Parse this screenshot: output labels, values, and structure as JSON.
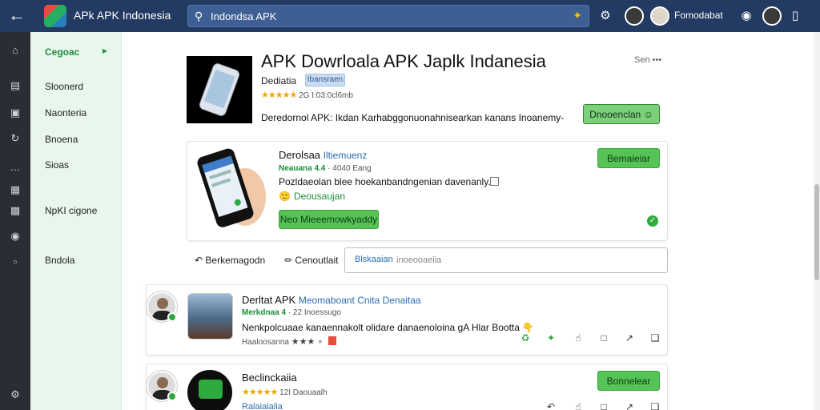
{
  "topbar": {
    "app_title": "APk APK Indonesia",
    "search_value": "Indondsa APK",
    "username": "Fomodabat"
  },
  "sidebar": {
    "header": "Cegoac",
    "items": [
      "Sloonerd",
      "Naonteria",
      "Bnoena",
      "Sioas",
      "NpKI cigone",
      "Bndola"
    ]
  },
  "hero": {
    "title": "APK Dowrloala APK Japlk Indanesia",
    "more": "Sen",
    "subtitle": "Dediatia",
    "badge": "Ibansraen",
    "rating_text": "2G I:03:0cl6mb",
    "description": "Deredornol APK: Ikdan Karhabggonuonahnisearkan kanans Inoanemy-",
    "download_label": "Dnooenclan"
  },
  "card1": {
    "title": "Derolsaa",
    "title_link": "Iltiemuenz",
    "meta_bold": "Neauana 4.4",
    "meta_rest": "· 4040 Eang",
    "description": "Pozldaeolan blee hoekanbandngenian davenanly.",
    "status_text": "Deousaujan",
    "action_label": "Neo Mieeemowkyaddy",
    "install_label": "Bemaieiar"
  },
  "actions": {
    "share_label": "Berkemagodn",
    "comment_label": "Cenoutlait",
    "comment_tag": "Blskaaian",
    "comment_placeholder": "inoeooaeiia"
  },
  "card2": {
    "title": "Derltat APK",
    "title_link": "Meomaboant Cnita Denaitaa",
    "meta_bold": "Merkdnaa 4",
    "meta_rest": "· 22 Inoessugo",
    "description": "Nenkpolcuaae kanaennakolt olidare danaenoloina gA Hlar Bootta",
    "footer_text": "Haaloosanna"
  },
  "card3": {
    "title": "Beclinckaiia",
    "rating_text": "12I Daouaalh",
    "install_label": "Bonnelear",
    "sub_text": "Ralaialalia"
  },
  "colors": {
    "topbar": "#233a63",
    "accent_green": "#56c356",
    "link_blue": "#2a6db2",
    "sidebar_bg": "#e8f6ec"
  },
  "icons": {
    "back": "arrow-left-icon",
    "search": "search-icon",
    "mic": "mic-icon",
    "settings": "gear-icon",
    "notifications": "bell-icon",
    "device": "phone-icon"
  }
}
